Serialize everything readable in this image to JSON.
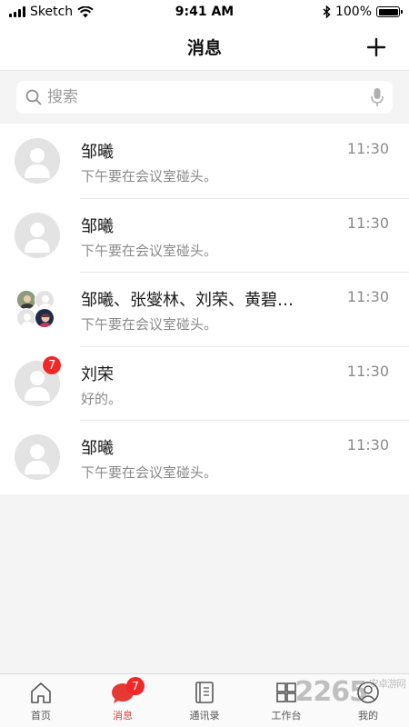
{
  "status_bar": {
    "carrier": "Sketch",
    "time": "9:41 AM",
    "battery": "100%"
  },
  "nav": {
    "title": "消息",
    "add_icon": "plus-icon"
  },
  "search": {
    "placeholder": "搜索",
    "icon": "search-icon",
    "mic_icon": "microphone-icon"
  },
  "conversations": [
    {
      "name": "邹曦",
      "message": "下午要在会议室碰头。",
      "time": "11:30",
      "avatar": "user-icon",
      "unread": ""
    },
    {
      "name": "邹曦",
      "message": "下午要在会议室碰头。",
      "time": "11:30",
      "avatar": "user-icon",
      "unread": ""
    },
    {
      "name": "邹曦、张燮林、刘荣、黄碧…",
      "message": "下午要在会议室碰头。",
      "time": "11:30",
      "avatar": "group-avatar",
      "unread": ""
    },
    {
      "name": "刘荣",
      "message": "好的。",
      "time": "11:30",
      "avatar": "user-icon",
      "unread": "7"
    },
    {
      "name": "邹曦",
      "message": "下午要在会议室碰头。",
      "time": "11:30",
      "avatar": "user-icon",
      "unread": ""
    }
  ],
  "tabs": [
    {
      "label": "首页",
      "icon": "home-icon"
    },
    {
      "label": "消息",
      "icon": "chat-bubble-icon",
      "badge": "7",
      "active": true
    },
    {
      "label": "通讯录",
      "icon": "contacts-book-icon"
    },
    {
      "label": "工作台",
      "icon": "grid-icon"
    },
    {
      "label": "我的",
      "icon": "profile-icon"
    }
  ],
  "watermark": {
    "text": "2265",
    "sub": "安卓游网",
    "tld": ".com"
  },
  "colors": {
    "accent": "#e53935",
    "badge": "#f02828",
    "background": "#f4f4f4"
  }
}
